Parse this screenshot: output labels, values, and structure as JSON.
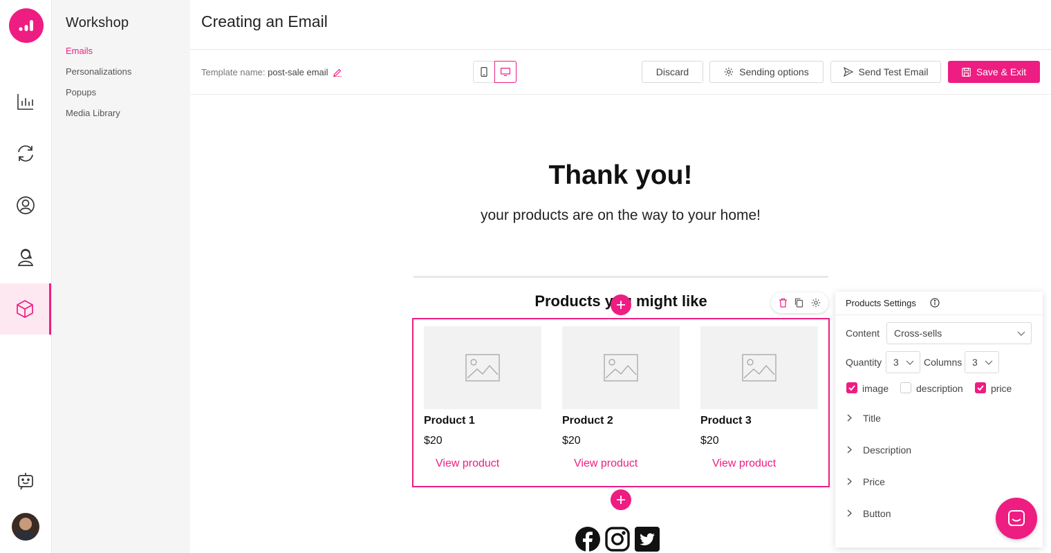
{
  "colors": {
    "accent": "#ee1d82",
    "subnav_bg": "#f5f5f5"
  },
  "rail": {
    "items": [
      {
        "icon": "analytics-icon"
      },
      {
        "icon": "sync-icon"
      },
      {
        "icon": "user-circle-icon"
      },
      {
        "icon": "agent-icon"
      },
      {
        "icon": "cube-icon",
        "active": true
      },
      {
        "icon": "bot-icon"
      }
    ]
  },
  "subnav": {
    "title": "Workshop",
    "items": [
      "Emails",
      "Personalizations",
      "Popups",
      "Media Library"
    ],
    "active_index": 0
  },
  "header": {
    "title": "Creating an Email"
  },
  "toolbar": {
    "template_label": "Template name:",
    "template_value": "post-sale email",
    "discard": "Discard",
    "sending_options": "Sending options",
    "send_test": "Send Test Email",
    "save_exit": "Save & Exit"
  },
  "email": {
    "title": "Thank you!",
    "subtitle": "your products are on the way to your home!",
    "products_title": "Products you might like",
    "products": [
      {
        "name": "Product 1",
        "price": "$20",
        "link": "View product"
      },
      {
        "name": "Product 2",
        "price": "$20",
        "link": "View product"
      },
      {
        "name": "Product 3",
        "price": "$20",
        "link": "View product"
      }
    ]
  },
  "settings": {
    "title": "Products Settings",
    "content_label": "Content",
    "content_value": "Cross-sells",
    "quantity_label": "Quantity",
    "quantity_value": "3",
    "columns_label": "Columns",
    "columns_value": "3",
    "checks": [
      {
        "label": "image",
        "checked": true
      },
      {
        "label": "description",
        "checked": false
      },
      {
        "label": "price",
        "checked": true
      }
    ],
    "sections": [
      "Title",
      "Description",
      "Price",
      "Button"
    ]
  }
}
